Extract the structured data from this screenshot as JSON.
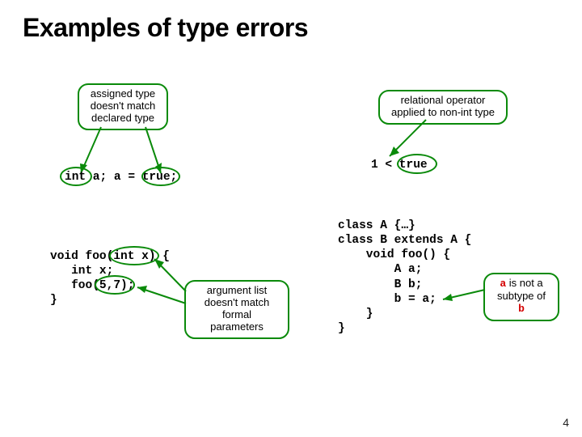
{
  "title": "Examples of type errors",
  "callouts": {
    "assigned": {
      "l1": "assigned type",
      "l2": "doesn't match",
      "l3": "declared type"
    },
    "relational": {
      "l1": "relational operator",
      "l2": "applied to non-int type"
    },
    "args": {
      "l1": "argument list",
      "l2": "doesn't match",
      "l3": "formal parameters"
    },
    "subtype": {
      "pre": "a",
      "mid1": " is not a",
      "mid2": "subtype of ",
      "post": "b"
    }
  },
  "code": {
    "line_decl": "int a; a = true;",
    "rel_expr": "1 < true",
    "foo": "void foo(int x) {\n   int x;\n   foo(5,7);\n}",
    "classes": "class A {…}\nclass B extends A {\n    void foo() {\n        A a;\n        B b;\n        b = a;\n    }\n}"
  },
  "page": "4"
}
